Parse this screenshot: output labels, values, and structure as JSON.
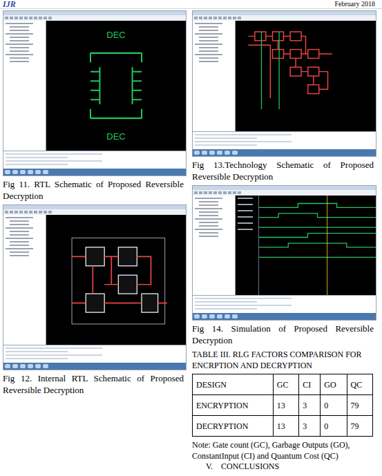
{
  "header": {
    "logo": "IJR",
    "date": "February 2018"
  },
  "figures": [
    {
      "kind": "rtl",
      "caption": "Fig 11. RTL Schematic of Proposed Reversible Decryption",
      "labels": [
        "DEC",
        "DEC"
      ]
    },
    {
      "kind": "internal",
      "caption": "Fig 12. Internal RTL Schematic of Proposed Reversible Decryption"
    },
    {
      "kind": "technology",
      "caption": "Fig 13.Technology Schematic of Proposed Reversible Decryption"
    },
    {
      "kind": "simulation",
      "caption": "Fig 14. Simulation of Proposed Reversible Decryption"
    }
  ],
  "table": {
    "title": "TABLE III. RLG FACTORS COMPARISON FOR ENCRPTION AND DECRYPTION",
    "columns": [
      "DESIGN",
      "GC",
      "CI",
      "GO",
      "QC"
    ],
    "rows": [
      [
        "ENCRYPTION",
        "13",
        "3",
        "0",
        "79"
      ],
      [
        "DECRYPTION",
        "13",
        "3",
        "0",
        "79"
      ]
    ]
  },
  "note": "Note: Gate count (GC), Garbage Outputs (GO), ConstantInput (CI) and Quantum Cost (QC)",
  "section": "V.    CONCLUSIONS"
}
